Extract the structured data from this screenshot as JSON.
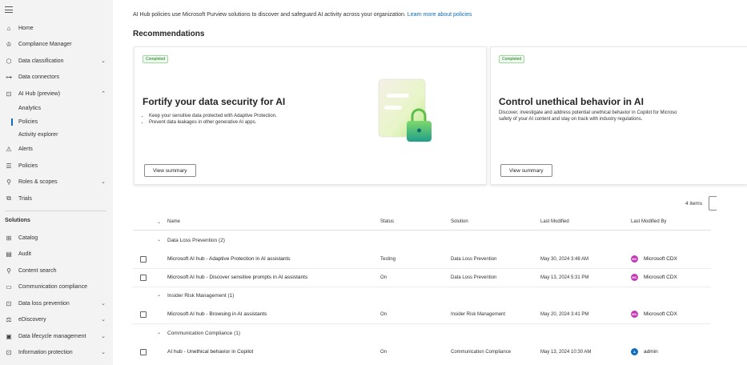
{
  "sidebar": {
    "items": [
      {
        "label": "Home",
        "icon": "home-icon",
        "glyph": "⌂"
      },
      {
        "label": "Compliance Manager",
        "icon": "trophy-icon",
        "glyph": "♔"
      },
      {
        "label": "Data classification",
        "icon": "tag-icon",
        "glyph": "⬡",
        "chevron": "⌄"
      },
      {
        "label": "Data connectors",
        "icon": "connector-icon",
        "glyph": "⊶"
      },
      {
        "label": "AI Hub (preview)",
        "icon": "ai-hub-icon",
        "glyph": "⊡",
        "chevron": "⌃"
      }
    ],
    "ai_hub_children": [
      "Analytics",
      "Policies",
      "Activity explorer"
    ],
    "items_2": [
      {
        "label": "Alerts",
        "icon": "alert-icon",
        "glyph": "⚠"
      },
      {
        "label": "Policies",
        "icon": "policies-icon",
        "glyph": "☰"
      },
      {
        "label": "Roles & scopes",
        "icon": "key-icon",
        "glyph": "⚲",
        "chevron": "⌄"
      },
      {
        "label": "Trials",
        "icon": "trials-icon",
        "glyph": "⧉"
      }
    ],
    "section_title": "Solutions",
    "solutions": [
      {
        "label": "Catalog",
        "icon": "catalog-icon",
        "glyph": "⊞"
      },
      {
        "label": "Audit",
        "icon": "audit-icon",
        "glyph": "▤"
      },
      {
        "label": "Content search",
        "icon": "search-icon",
        "glyph": "⚲"
      },
      {
        "label": "Communication compliance",
        "icon": "chat-icon",
        "glyph": "▭"
      },
      {
        "label": "Data loss prevention",
        "icon": "dlp-icon",
        "glyph": "⊡",
        "chevron": "⌄"
      },
      {
        "label": "eDiscovery",
        "icon": "ediscovery-icon",
        "glyph": "⚖",
        "chevron": "⌄"
      },
      {
        "label": "Data lifecycle management",
        "icon": "lifecycle-icon",
        "glyph": "▣",
        "chevron": "⌄"
      },
      {
        "label": "Information protection",
        "icon": "info-protection-icon",
        "glyph": "⊡",
        "chevron": "⌄"
      }
    ]
  },
  "intro": {
    "text": "AI Hub policies use Microsoft Purview solutions to discover and safeguard AI activity across your organization.",
    "link": "Learn more about policies"
  },
  "recommendations_title": "Recommendations",
  "cards": [
    {
      "badge": "Completed",
      "title": "Fortify your data security for AI",
      "bullets": [
        "Keep your sensitive data protected with Adaptive Protection.",
        "Prevent data leakages in other generative AI apps."
      ],
      "button": "View summary"
    },
    {
      "badge": "Completed",
      "title": "Control unethical behavior in AI",
      "desc_line1": "Discover, investigate and address potential unethical behavior in Copilot for Microso",
      "desc_line2": "safety of your AI content and stay on track with industry regulations.",
      "button": "View summary"
    }
  ],
  "table": {
    "items_count": "4 items",
    "headers": {
      "name": "Name",
      "status": "Status",
      "solution": "Solution",
      "last_modified": "Last Modified",
      "last_modified_by": "Last Modified By"
    },
    "groups": [
      {
        "label": "Data Loss Prevention (2)"
      },
      {
        "label": "Insider Risk Management (1)"
      },
      {
        "label": "Communication Compliance (1)"
      }
    ],
    "rows": [
      {
        "name": "Microsoft AI hub - Adaptive Protection in AI assistants",
        "status": "Testing",
        "solution": "Data Loss Prevention",
        "modified": "May 30, 2024 3:48 AM",
        "by": "Microsoft CDX",
        "initials": "MC"
      },
      {
        "name": "Microsoft AI hub - Discover sensitive prompts in AI assistants",
        "status": "On",
        "solution": "Data Loss Prevention",
        "modified": "May 13, 2024 5:31 PM",
        "by": "Microsoft CDX",
        "initials": "MC"
      },
      {
        "name": "Microsoft AI hub - Browsing in AI assistants",
        "status": "On",
        "solution": "Insider Risk Management",
        "modified": "May 20, 2024 3:41 PM",
        "by": "Microsoft CDX",
        "initials": "MC"
      },
      {
        "name": "AI hub - Unethical behavior in Copilot",
        "status": "On",
        "solution": "Communication Compliance",
        "modified": "May 13, 2024 10:30 AM",
        "by": "admin",
        "initials": "A"
      }
    ]
  },
  "colors": {
    "accent": "#0f6cbd",
    "avatar_mc": "#c239b3",
    "avatar_admin": "#0f6cbd"
  }
}
